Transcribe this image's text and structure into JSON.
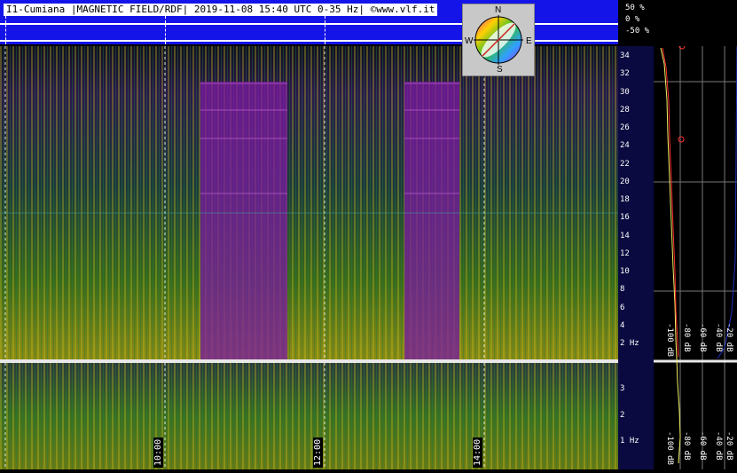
{
  "header": {
    "title": "I1-Cumiana |MAGNETIC FIELD/RDF| 2019-11-08 15:40 UTC 0-35 Hz| ©www.vlf.it",
    "pct_top": "50 %",
    "pct_mid": "0 %",
    "pct_bot": "-50 %"
  },
  "compass": {
    "n": "N",
    "e": "E",
    "s": "S",
    "w": "W"
  },
  "freq_ticks_upper": [
    "34",
    "32",
    "30",
    "28",
    "26",
    "24",
    "22",
    "20",
    "18",
    "16",
    "14",
    "12",
    "10",
    "8",
    "6",
    "4",
    "2 Hz"
  ],
  "freq_ticks_lower": [
    "3",
    "2",
    "1 Hz"
  ],
  "time_labels": [
    "10:00",
    "12:00",
    "14:00"
  ],
  "db_labels_upper": [
    "-100 dB",
    "-80 dB",
    "-60 dB",
    "-40 dB",
    "-20 dB"
  ],
  "db_labels_lower": [
    "-100 dB",
    "-80 dB",
    "-60 dB",
    "-40 dB",
    "-20 dB"
  ],
  "colors": {
    "header_blue": "#1414e8",
    "magenta_band": "#8a1aa8",
    "green_noise": "#3c7a1c"
  }
}
